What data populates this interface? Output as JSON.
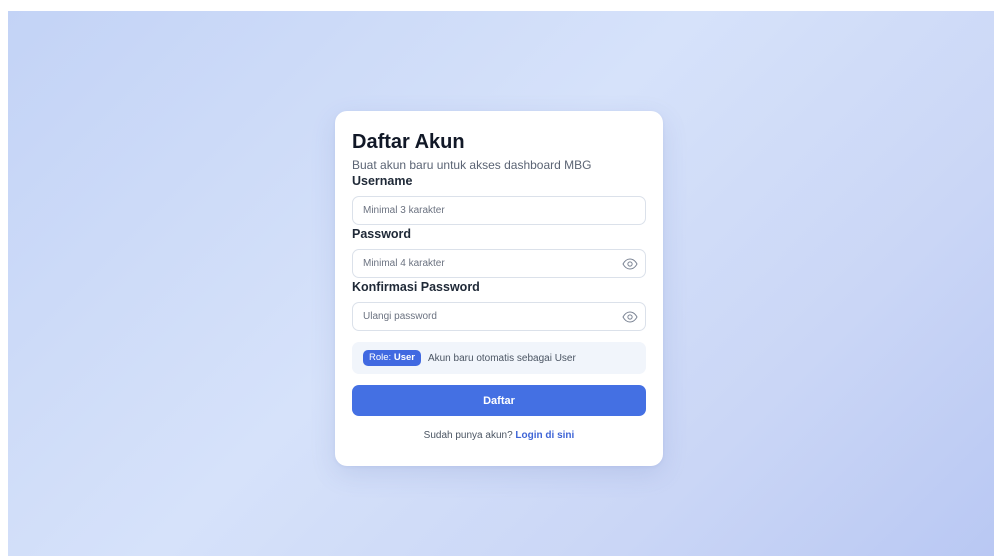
{
  "card": {
    "title": "Daftar Akun",
    "subtitle": "Buat akun baru untuk akses dashboard MBG"
  },
  "form": {
    "username": {
      "label": "Username",
      "value": "",
      "placeholder": "Minimal 3 karakter"
    },
    "password": {
      "label": "Password",
      "value": "",
      "placeholder": "Minimal 4 karakter",
      "toggle_icon": "eye-icon"
    },
    "confirm_password": {
      "label": "Konfirmasi Password",
      "value": "",
      "placeholder": "Ulangi password",
      "toggle_icon": "eye-icon"
    }
  },
  "role": {
    "badge_prefix": "Role: ",
    "badge_value": "User",
    "note": "Akun baru otomatis sebagai User"
  },
  "submit": {
    "label": "Daftar"
  },
  "footer": {
    "prompt": "Sudah punya akun? ",
    "link": "Login di sini"
  },
  "colors": {
    "accent": "#4470e3",
    "badge": "#4169e1",
    "link": "#3f65d6",
    "background_start": "#c3d3f6",
    "background_end": "#b9c8f3"
  }
}
